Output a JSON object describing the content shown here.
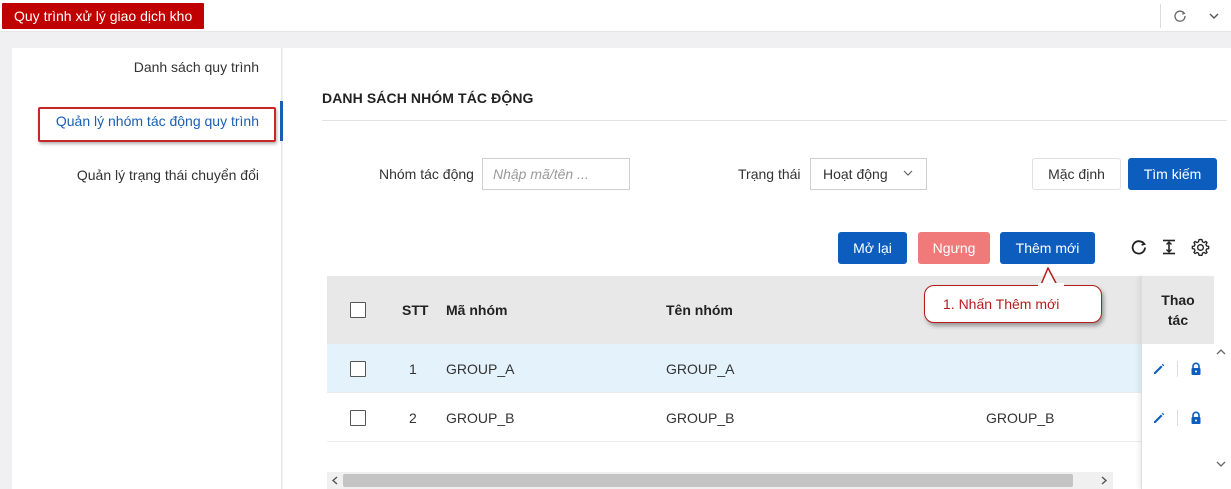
{
  "app": {
    "tab_title": "Quy trình xử lý giao dịch kho"
  },
  "topbar": {
    "icons": [
      "refresh-icon",
      "chevron-down-icon"
    ]
  },
  "sidenav": {
    "items": [
      {
        "label": "Danh sách quy trình",
        "active": false
      },
      {
        "label": "Quản lý nhóm tác động quy trình",
        "active": true
      },
      {
        "label": "Quản lý trạng thái chuyển đổi",
        "active": false
      }
    ]
  },
  "main": {
    "section_title": "DANH SÁCH NHÓM TÁC ĐỘNG",
    "filters": {
      "group_label": "Nhóm tác động",
      "group_placeholder": "Nhập mã/tên ...",
      "status_label": "Trạng thái",
      "status_value": "Hoạt động",
      "default_button": "Mặc định",
      "search_button": "Tìm kiếm"
    },
    "actions": {
      "reopen_button": "Mở lại",
      "stop_button": "Ngưng",
      "add_button": "Thêm mới",
      "tool_icons": [
        "refresh-icon",
        "column-height-icon",
        "settings-icon"
      ]
    },
    "table": {
      "columns": {
        "stt": "STT",
        "code": "Mã nhóm",
        "name": "Tên nhóm",
        "actions_line1": "Thao",
        "actions_line2": "tác"
      },
      "rows": [
        {
          "stt": "1",
          "code": "GROUP_A",
          "name": "GROUP_A",
          "extra": ""
        },
        {
          "stt": "2",
          "code": "GROUP_B",
          "name": "GROUP_B",
          "extra": "GROUP_B"
        }
      ]
    }
  },
  "callout": {
    "text": "1. Nhấn Thêm mới"
  },
  "colors": {
    "brand_red": "#c00000",
    "primary_blue": "#0d5dbf",
    "danger_pink": "#f07a7a",
    "row_highlight": "#e3f2fb",
    "callout_red": "#b71c1c"
  }
}
